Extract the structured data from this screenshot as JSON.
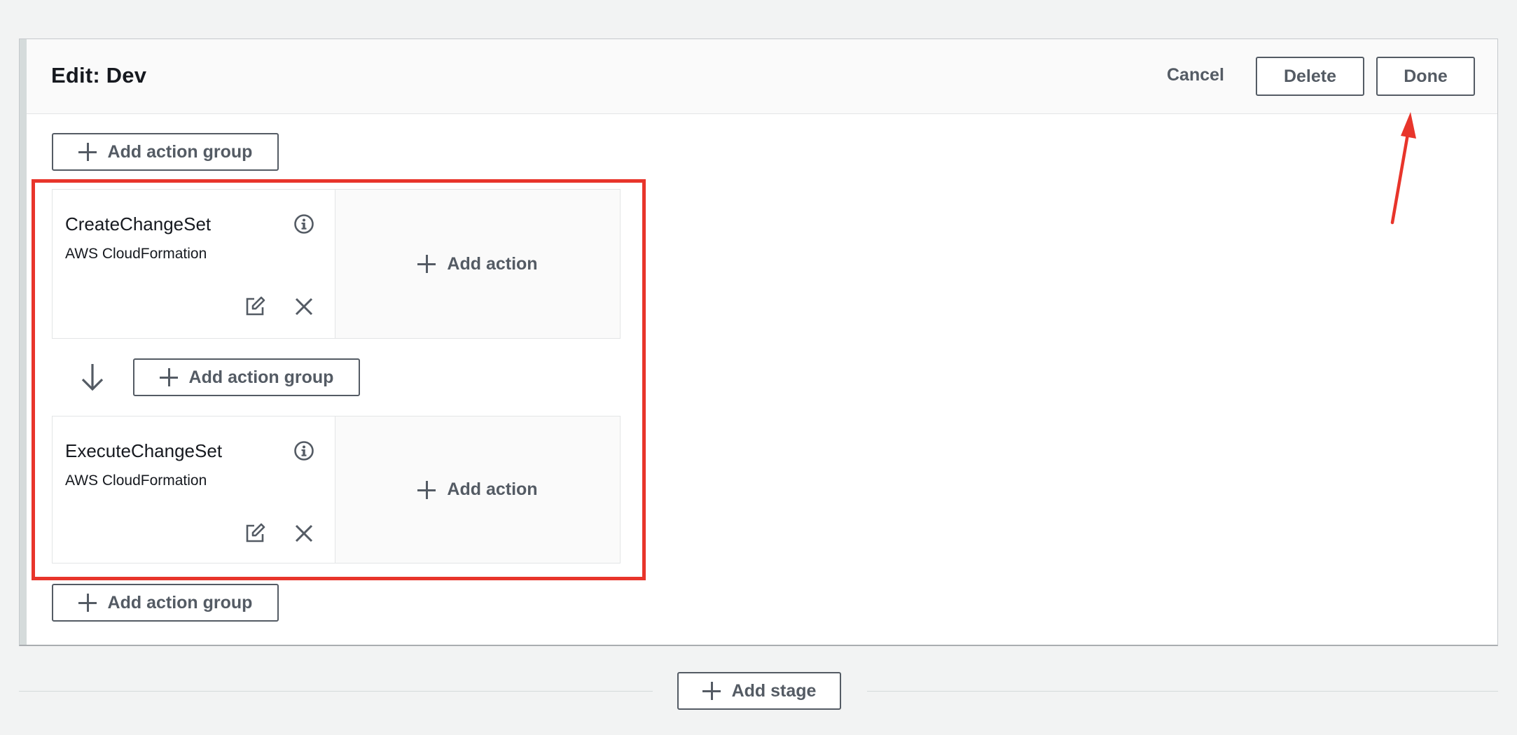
{
  "stage": {
    "title": "Edit: Dev",
    "cancel_label": "Cancel",
    "delete_label": "Delete",
    "done_label": "Done"
  },
  "add_action_group_label": "Add action group",
  "add_action_label": "Add action",
  "add_stage_label": "Add stage",
  "actions": [
    {
      "name": "CreateChangeSet",
      "provider": "AWS CloudFormation"
    },
    {
      "name": "ExecuteChangeSet",
      "provider": "AWS CloudFormation"
    }
  ],
  "colors": {
    "highlight": "#e8352b",
    "button_text": "#545b64",
    "background": "#f2f3f3"
  },
  "icons": [
    "plus-icon",
    "info-icon",
    "edit-icon",
    "close-icon",
    "arrow-down-icon"
  ]
}
